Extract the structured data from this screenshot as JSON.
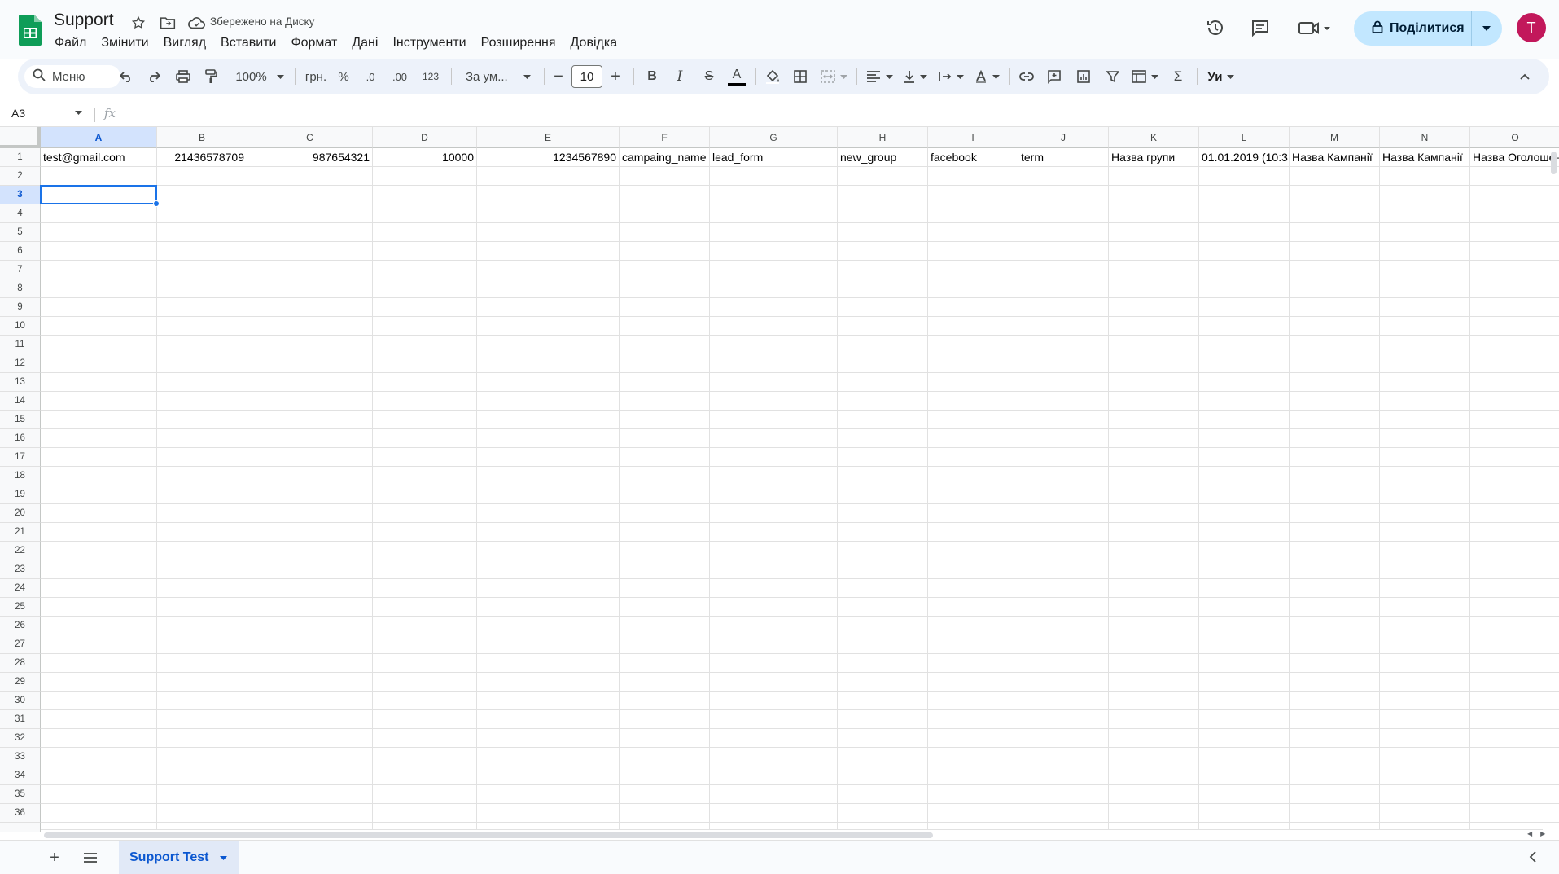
{
  "header": {
    "title": "Support",
    "saved_status": "Збережено на Диску",
    "menu": [
      "Файл",
      "Змінити",
      "Вигляд",
      "Вставити",
      "Формат",
      "Дані",
      "Інструменти",
      "Розширення",
      "Довідка"
    ],
    "share_label": "Поділитися",
    "avatar_letter": "T"
  },
  "toolbar": {
    "search_label": "Меню",
    "zoom": "100%",
    "currency": "грн.",
    "percent": "%",
    "dec_decrease": ".0",
    "dec_increase": ".00",
    "more_formats": "123",
    "font": "За ум...",
    "font_size": "10"
  },
  "formula_bar": {
    "name_box": "A3",
    "fx_label": "fx"
  },
  "grid": {
    "columns": [
      "A",
      "B",
      "C",
      "D",
      "E",
      "F",
      "G",
      "H",
      "I",
      "J",
      "K",
      "L",
      "M",
      "N",
      "O"
    ],
    "selected_column": "A",
    "selected_row": 3,
    "rows": [
      "1",
      "2",
      "3",
      "4",
      "5",
      "6",
      "7",
      "8",
      "9",
      "10",
      "11",
      "12",
      "13",
      "14",
      "15",
      "16",
      "17",
      "18",
      "19",
      "20",
      "21",
      "22",
      "23",
      "24",
      "25",
      "26",
      "27",
      "28",
      "29",
      "30",
      "31",
      "32",
      "33",
      "34",
      "35",
      "36"
    ],
    "row1": {
      "A": "test@gmail.com",
      "B": "21436578709",
      "C": "987654321",
      "D": "10000",
      "E": "1234567890",
      "F": "campaing_name",
      "G": "lead_form",
      "H": "new_group",
      "I": "facebook",
      "J": "term",
      "K": "Назва групи",
      "L": "01.01.2019 (10:3",
      "M": "Назва Кампанії",
      "N": "Назва Кампанії",
      "O": "Назва Оголошен"
    }
  },
  "sheets": {
    "active": "Support Test"
  }
}
